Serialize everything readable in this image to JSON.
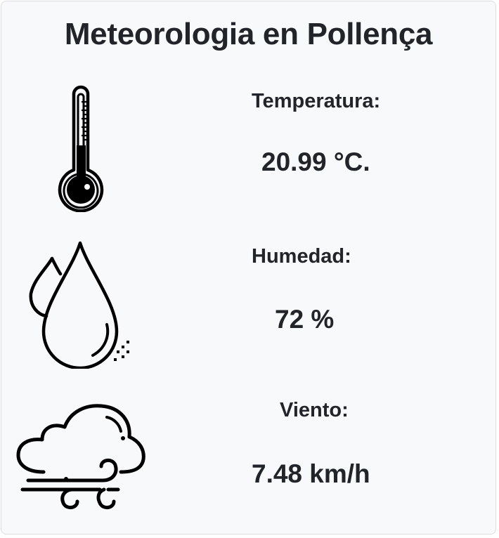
{
  "app": {
    "title": "Meteorologia en Pollença"
  },
  "metrics": [
    {
      "label": "Temperatura:",
      "value": "20.99 °C.",
      "icon": "thermometer-icon"
    },
    {
      "label": "Humedad:",
      "value": "72 %",
      "icon": "water-drops-icon"
    },
    {
      "label": "Viento:",
      "value": "7.48 km/h",
      "icon": "cloud-wind-icon"
    }
  ],
  "colors": {
    "background": "#f8f9fa",
    "border": "#dcdee2",
    "text": "#212529",
    "icon": "#000000"
  }
}
